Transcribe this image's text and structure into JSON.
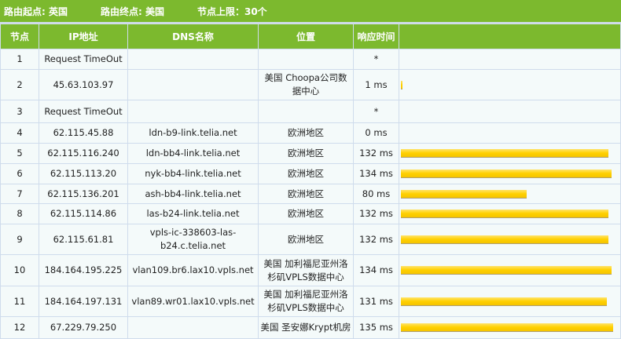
{
  "summary": {
    "start": "路由起点: 英国",
    "end": "路由终点: 美国",
    "limit": "节点上限：30个"
  },
  "headers": [
    "节点",
    "IP地址",
    "DNS名称",
    "位置",
    "响应时间",
    ""
  ],
  "rows": [
    {
      "hop": "1",
      "ip": "Request TimeOut",
      "dns": "",
      "loc": "",
      "time": "*",
      "ms": 0,
      "h": 26
    },
    {
      "hop": "2",
      "ip": "45.63.103.97",
      "dns": "",
      "loc": "美国 Choopa公司数据中心",
      "time": "1 ms",
      "ms": 1,
      "h": 39
    },
    {
      "hop": "3",
      "ip": "Request TimeOut",
      "dns": "",
      "loc": "",
      "time": "*",
      "ms": 0,
      "h": 29
    },
    {
      "hop": "4",
      "ip": "62.115.45.88",
      "dns": "ldn-b9-link.telia.net",
      "loc": "欧洲地区",
      "time": "0 ms",
      "ms": 0,
      "h": 26
    },
    {
      "hop": "5",
      "ip": "62.115.116.240",
      "dns": "ldn-bb4-link.telia.net",
      "loc": "欧洲地区",
      "time": "132 ms",
      "ms": 132,
      "h": 26
    },
    {
      "hop": "6",
      "ip": "62.115.113.20",
      "dns": "nyk-bb4-link.telia.net",
      "loc": "欧洲地区",
      "time": "134 ms",
      "ms": 134,
      "h": 26
    },
    {
      "hop": "7",
      "ip": "62.115.136.201",
      "dns": "ash-bb4-link.telia.net",
      "loc": "欧洲地区",
      "time": "80 ms",
      "ms": 80,
      "h": 25
    },
    {
      "hop": "8",
      "ip": "62.115.114.86",
      "dns": "las-b24-link.telia.net",
      "loc": "欧洲地区",
      "time": "132 ms",
      "ms": 132,
      "h": 26
    },
    {
      "hop": "9",
      "ip": "62.115.61.81",
      "dns": "vpls-ic-338603-las-b24.c.telia.net",
      "loc": "欧洲地区",
      "time": "132 ms",
      "ms": 132,
      "h": 39
    },
    {
      "hop": "10",
      "ip": "184.164.195.225",
      "dns": "vlan109.br6.lax10.vpls.net",
      "loc": "美国 加利福尼亚州洛杉矶VPLS数据中心",
      "time": "134 ms",
      "ms": 134,
      "h": 40
    },
    {
      "hop": "11",
      "ip": "184.164.197.131",
      "dns": "vlan89.wr01.lax10.vpls.net",
      "loc": "美国 加利福尼亚州洛杉矶VPLS数据中心",
      "time": "131 ms",
      "ms": 131,
      "h": 39
    },
    {
      "hop": "12",
      "ip": "67.229.79.250",
      "dns": "",
      "loc": "美国 圣安娜Krypt机房",
      "time": "135 ms",
      "ms": 135,
      "h": 28
    }
  ]
}
